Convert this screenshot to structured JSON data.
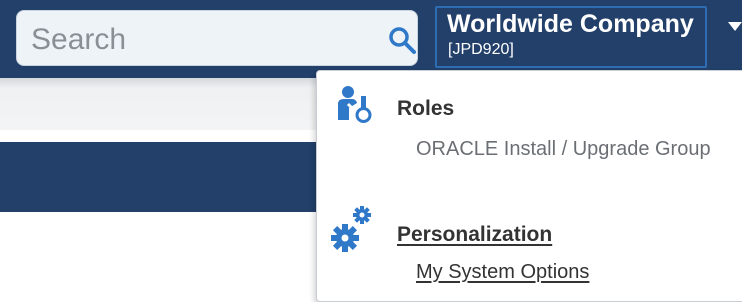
{
  "search": {
    "placeholder": "Search"
  },
  "company": {
    "name": "Worldwide Company",
    "code": "[JPD920]"
  },
  "menu": {
    "roles": {
      "title": "Roles",
      "items": [
        "ORACLE Install / Upgrade Group"
      ]
    },
    "personalization": {
      "title": "Personalization",
      "items": [
        "My System Options"
      ]
    }
  },
  "colors": {
    "header": "#22406a",
    "accent": "#2e6db3",
    "icon_blue": "#2f79c8"
  },
  "icons": [
    "search-icon",
    "chevron-down-icon",
    "user-roles-icon",
    "gears-icon"
  ]
}
